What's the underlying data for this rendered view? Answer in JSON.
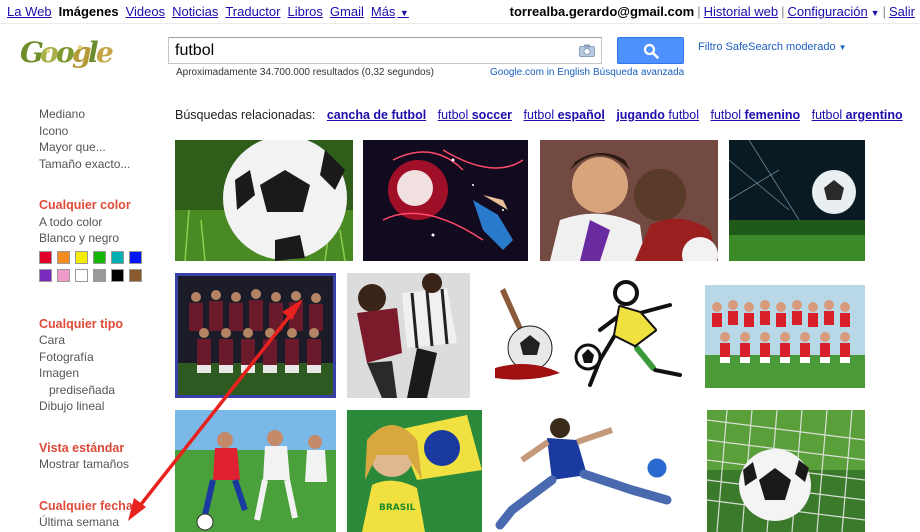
{
  "topnav": {
    "items": [
      "La Web",
      "Imágenes",
      "Videos",
      "Noticias",
      "Traductor",
      "Libros",
      "Gmail",
      "Más"
    ]
  },
  "user": {
    "email": "torrealba.gerardo@gmail.com",
    "history": "Historial web",
    "settings": "Configuración",
    "signout": "Salir"
  },
  "search": {
    "query": "futbol",
    "safesearch": "Filtro SafeSearch moderado",
    "results": "Aproximadamente 34.700.000 resultados (0,32 segundos)",
    "english_link": "Google.com in English",
    "advanced_link": "Búsqueda avanzada"
  },
  "sidebar": {
    "size_items": [
      "Mediano",
      "Icono",
      "Mayor que...",
      "Tamaño exacto..."
    ],
    "color_head": "Cualquier color",
    "color_items": [
      "A todo color",
      "Blanco y negro"
    ],
    "swatch_colors": [
      "#e0002a",
      "#f68b1f",
      "#f5ed00",
      "#14b600",
      "#00b0b0",
      "#0016f7",
      "#7a2bbd",
      "#f29bcb",
      "#ffffff",
      "#9a9a9a",
      "#000000",
      "#8a5a2c"
    ],
    "type_head": "Cualquier tipo",
    "type_items": [
      "Cara",
      "Fotografía",
      "Imagen",
      "prediseñada",
      "Dibujo lineal"
    ],
    "view_head": "Vista estándar",
    "view_items": [
      "Mostrar tamaños"
    ],
    "date_head": "Cualquier fecha",
    "date_items": [
      "Última semana"
    ]
  },
  "related": {
    "label": "Búsquedas relacionadas:",
    "items": [
      {
        "pre": "cancha de futbol",
        "bold": ""
      },
      {
        "pre": "futbol ",
        "bold": "soccer"
      },
      {
        "pre": "futbol ",
        "bold": "español"
      },
      {
        "pre": "jugando ",
        "bold": "futbol"
      },
      {
        "pre": "futbol ",
        "bold": "femenino"
      },
      {
        "pre": "futbol ",
        "bold": "argentino"
      }
    ]
  },
  "colors": {
    "link": "#1a0dab",
    "sidebar_head": "#dd4b39",
    "search_button": "#4d90fe",
    "annotation_arrow": "#e8221e"
  }
}
